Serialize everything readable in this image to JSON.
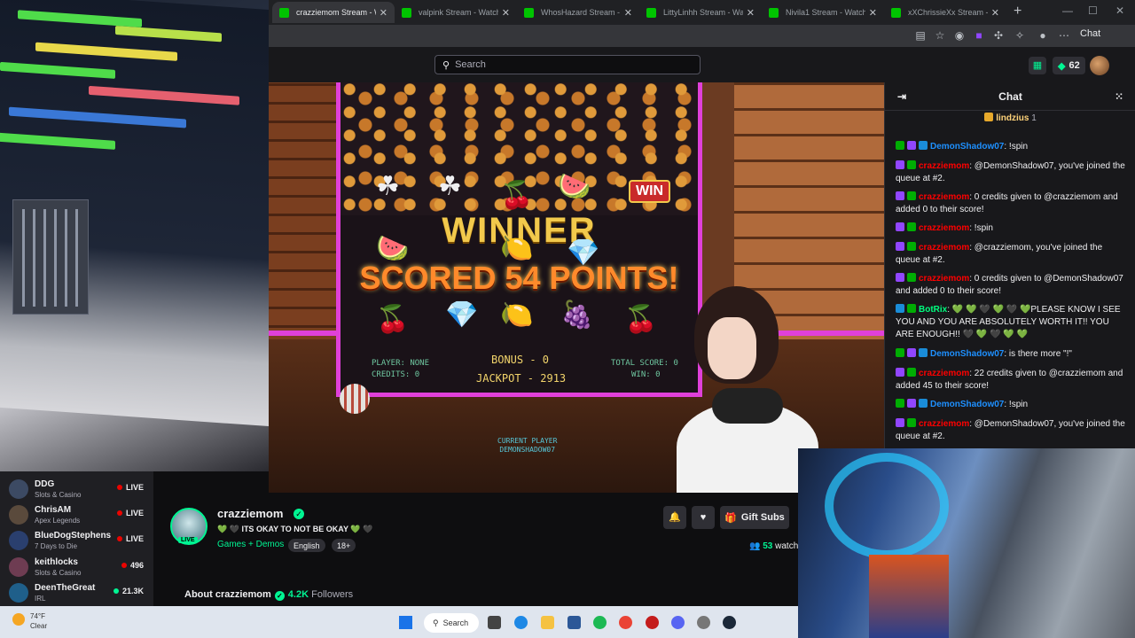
{
  "browser": {
    "tabs": [
      {
        "title": "crazziemom Stream - W",
        "active": true
      },
      {
        "title": "valpink Stream - Watch Live"
      },
      {
        "title": "WhosHazard Stream - Watch"
      },
      {
        "title": "LittyLinhh Stream - Watch Li"
      },
      {
        "title": "Nivila1 Stream - Watch Live"
      },
      {
        "title": "xXChrissieXx Stream - W"
      }
    ],
    "new_tab": "+",
    "window_controls": {
      "min": "—",
      "max": "☐",
      "close": "✕"
    },
    "extension_label": "Chat"
  },
  "nav": {
    "search_placeholder": "Search",
    "bits_count": "62"
  },
  "video": {
    "machine": {
      "winner": "WINNER",
      "scored": "SCORED 54 POINTS!",
      "win_badge": "WIN",
      "player": "PLAYER: NONE",
      "credits": "CREDITS: 0",
      "bonus": "BONUS - 0",
      "jackpot": "JACKPOT - 2913",
      "total_score": "TOTAL SCORE: 0",
      "win": "WIN: 0",
      "current_player_label": "CURRENT PLAYER",
      "current_player_name": "DEMONSHADOW07"
    }
  },
  "chat": {
    "title": "Chat",
    "pinned": {
      "user": "lindzius",
      "count": "1"
    },
    "messages": [
      {
        "user": "DemonShadow07",
        "color": "blue",
        "text": ": !spin",
        "badges": [
          "mod",
          "sub",
          "vip"
        ]
      },
      {
        "user": "crazziemom",
        "color": "red",
        "text": ": @DemonShadow07, you've joined the queue at #2.",
        "badges": [
          "sub",
          "mod"
        ]
      },
      {
        "user": "crazziemom",
        "color": "red",
        "text": ": 0 credits given to @crazziemom and added 0 to their score!",
        "badges": [
          "sub",
          "mod"
        ]
      },
      {
        "user": "crazziemom",
        "color": "red",
        "text": ": !spin",
        "badges": [
          "sub",
          "mod"
        ]
      },
      {
        "user": "crazziemom",
        "color": "red",
        "text": ": @crazziemom, you've joined the queue at #2.",
        "badges": [
          "sub",
          "mod"
        ]
      },
      {
        "user": "crazziemom",
        "color": "red",
        "text": ": 0 credits given to @DemonShadow07 and added 0 to their score!",
        "badges": [
          "sub",
          "mod"
        ]
      },
      {
        "user": "BotRix",
        "color": "green",
        "text": ": 💚 💚 🖤 💚 🖤 💚PLEASE KNOW I SEE YOU AND YOU ARE ABSOLUTELY WORTH IT!! YOU ARE ENOUGH!! 🖤 💚 🖤 💚 💚",
        "badges": [
          "vip",
          "mod"
        ]
      },
      {
        "user": "DemonShadow07",
        "color": "blue",
        "text": ": is there more \"!\"",
        "badges": [
          "mod",
          "sub",
          "vip"
        ]
      },
      {
        "user": "crazziemom",
        "color": "red",
        "text": ": 22 credits given to @crazziemom and added 45 to their score!",
        "badges": [
          "sub",
          "mod"
        ]
      },
      {
        "user": "DemonShadow07",
        "color": "blue",
        "text": ": !spin",
        "badges": [
          "mod",
          "sub",
          "vip"
        ]
      },
      {
        "user": "crazziemom",
        "color": "red",
        "text": ": @DemonShadow07, you've joined the queue at #2.",
        "badges": [
          "sub",
          "mod"
        ]
      }
    ]
  },
  "sidebar": {
    "channels": [
      {
        "name": "DDG",
        "game": "Slots & Casino",
        "status": "LIVE",
        "kind": "live"
      },
      {
        "name": "ChrisAM",
        "game": "Apex Legends",
        "status": "LIVE",
        "kind": "live"
      },
      {
        "name": "BlueDogStephens",
        "game": "7 Days to Die",
        "status": "LIVE",
        "kind": "live"
      },
      {
        "name": "keithlocks",
        "game": "Slots & Casino",
        "status": "496",
        "kind": "count"
      },
      {
        "name": "DeenTheGreat",
        "game": "IRL",
        "status": "21.3K",
        "kind": "count"
      }
    ]
  },
  "channel": {
    "name": "crazziemom",
    "live_tag": "LIVE",
    "title": "ITS OKAY TO NOT BE OKAY",
    "title_hearts": "💚 🖤",
    "category": "Games + Demos",
    "tags": [
      "English",
      "18+"
    ],
    "gift_label": "Gift Subs",
    "viewers_count": "53",
    "viewers_label": "watch",
    "about_label": "About crazziemom",
    "followers_count": "4.2K",
    "followers_label": "Followers"
  },
  "taskbar": {
    "temp": "74°F",
    "condition": "Clear",
    "search_label": "Search"
  }
}
